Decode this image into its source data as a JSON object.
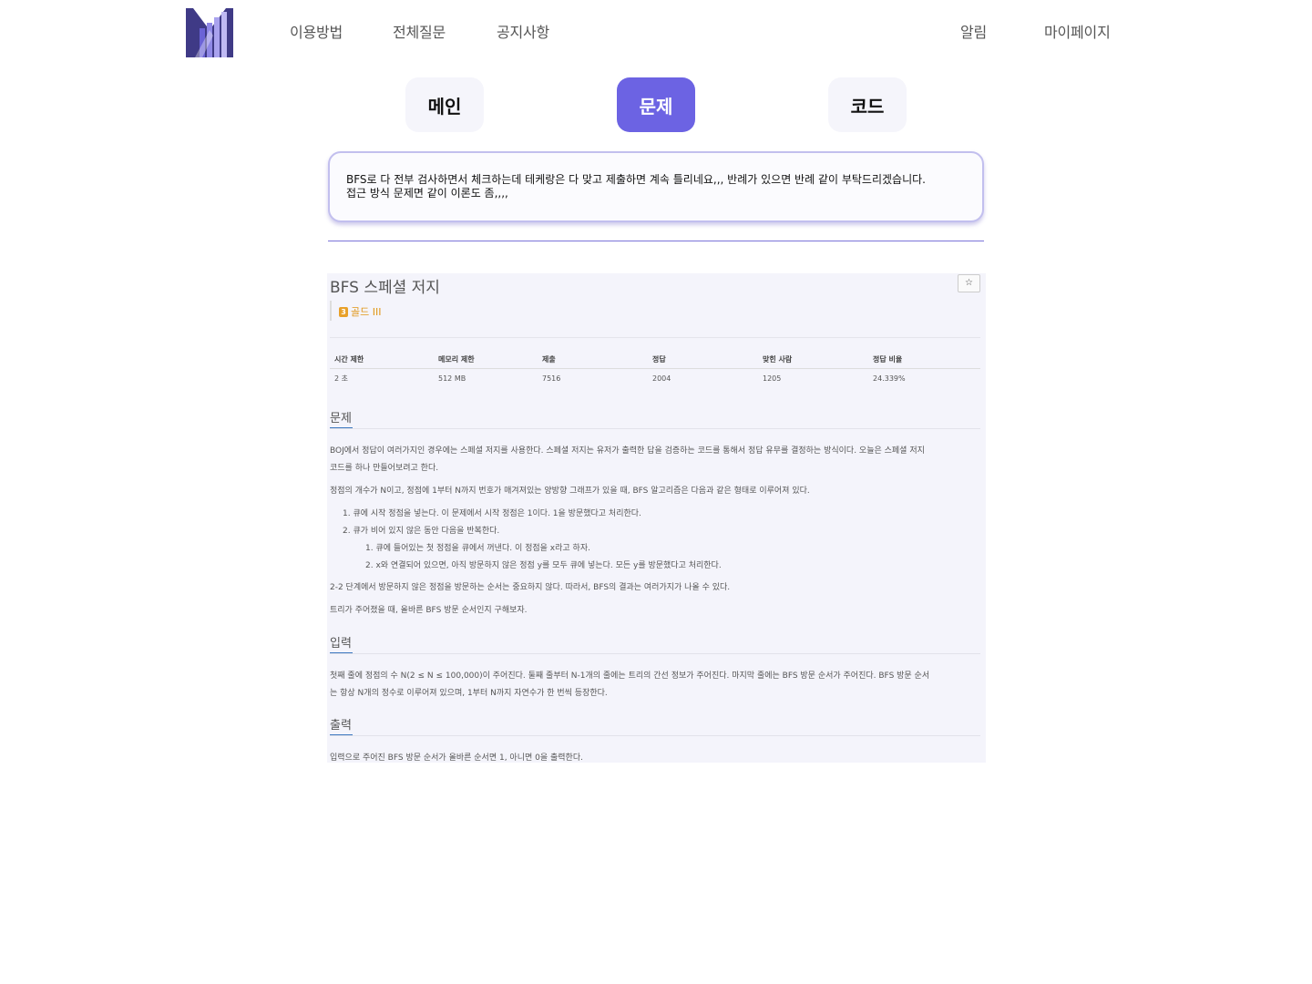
{
  "nav": {
    "links": [
      "이용방법",
      "전체질문",
      "공지사항"
    ],
    "alarm": "알림",
    "mypage": "마이페이지"
  },
  "tabs": [
    {
      "label": "메인",
      "active": false
    },
    {
      "label": "문제",
      "active": true
    },
    {
      "label": "코드",
      "active": false
    }
  ],
  "question": {
    "line1": "BFS로 다 전부 검사하면서 체크하는데 테케랑은 다 맞고 제출하면 계속 틀리네요,,, 반례가 있으면 반례 같이 부탁드리겠습니다.",
    "line2": "접근 방식 문제면 같이 이론도 좀,,,,"
  },
  "problem": {
    "title": "BFS 스페셜 저지",
    "star": "☆",
    "tier_badge": "3",
    "tier": "골드 III",
    "table": {
      "headers": [
        "시간 제한",
        "메모리 제한",
        "제출",
        "정답",
        "맞힌 사람",
        "정답 비율"
      ],
      "values": [
        "2 초",
        "512 MB",
        "7516",
        "2004",
        "1205",
        "24.339%"
      ]
    },
    "sections": {
      "problem_h": "문제",
      "problem_p1a": "BOJ에서 정답이 여러가지인 경우에는 스페셜 저지를 사용한다. 스페셜 저지는 유저가 출력한 답을 검증하는 코드를 통해서 정답 유무를 결정하는 방식이다. 오늘은 스페셜 저지",
      "problem_p1b": "코드를 하나 만들어보려고 한다.",
      "problem_p2": "정점의 개수가 N이고, 정점에 1부터 N까지 번호가 매겨져있는 양방향 그래프가 있을 때, BFS 알고리즘은 다음과 같은 형태로 이루어져 있다.",
      "list1": "1. 큐에 시작 정점을 넣는다. 이 문제에서 시작 정점은 1이다. 1을 방문했다고 처리한다.",
      "list2": "2. 큐가 비어 있지 않은 동안 다음을 반복한다.",
      "list2_1": "1. 큐에 들어있는 첫 정점을 큐에서 꺼낸다. 이 정점을 x라고 하자.",
      "list2_2": "2. x와 연결되어 있으면, 아직 방문하지 않은 정점 y를 모두 큐에 넣는다. 모든 y를 방문했다고 처리한다.",
      "problem_p3": "2-2 단계에서 방문하지 않은 정점을 방문하는 순서는 중요하지 않다. 따라서, BFS의 결과는 여러가지가 나올 수 있다.",
      "problem_p4": "트리가 주어졌을 때, 올바른 BFS 방문 순서인지 구해보자.",
      "input_h": "입력",
      "input_p1": "첫째 줄에 정점의 수 N(2 ≤ N ≤ 100,000)이 주어진다. 둘째 줄부터 N-1개의 줄에는 트리의 간선 정보가 주어진다. 마지막 줄에는 BFS 방문 순서가 주어진다. BFS 방문 순서",
      "input_p2": "는 항상 N개의 정수로 이루어져 있으며, 1부터 N까지 자연수가 한 번씩 등장한다.",
      "output_h": "출력",
      "output_p1": "입력으로 주어진 BFS 방문 순서가 올바른 순서면 1, 아니면 0을 출력한다."
    }
  },
  "colors": {
    "accent": "#6c63e3",
    "tab_inactive_bg": "#f5f5fb",
    "tier_gold": "#e09515",
    "section_underline": "#3b78c0"
  },
  "icons": {
    "logo": "service-logo",
    "star": "star-icon",
    "tier": "gold-tier-icon"
  }
}
